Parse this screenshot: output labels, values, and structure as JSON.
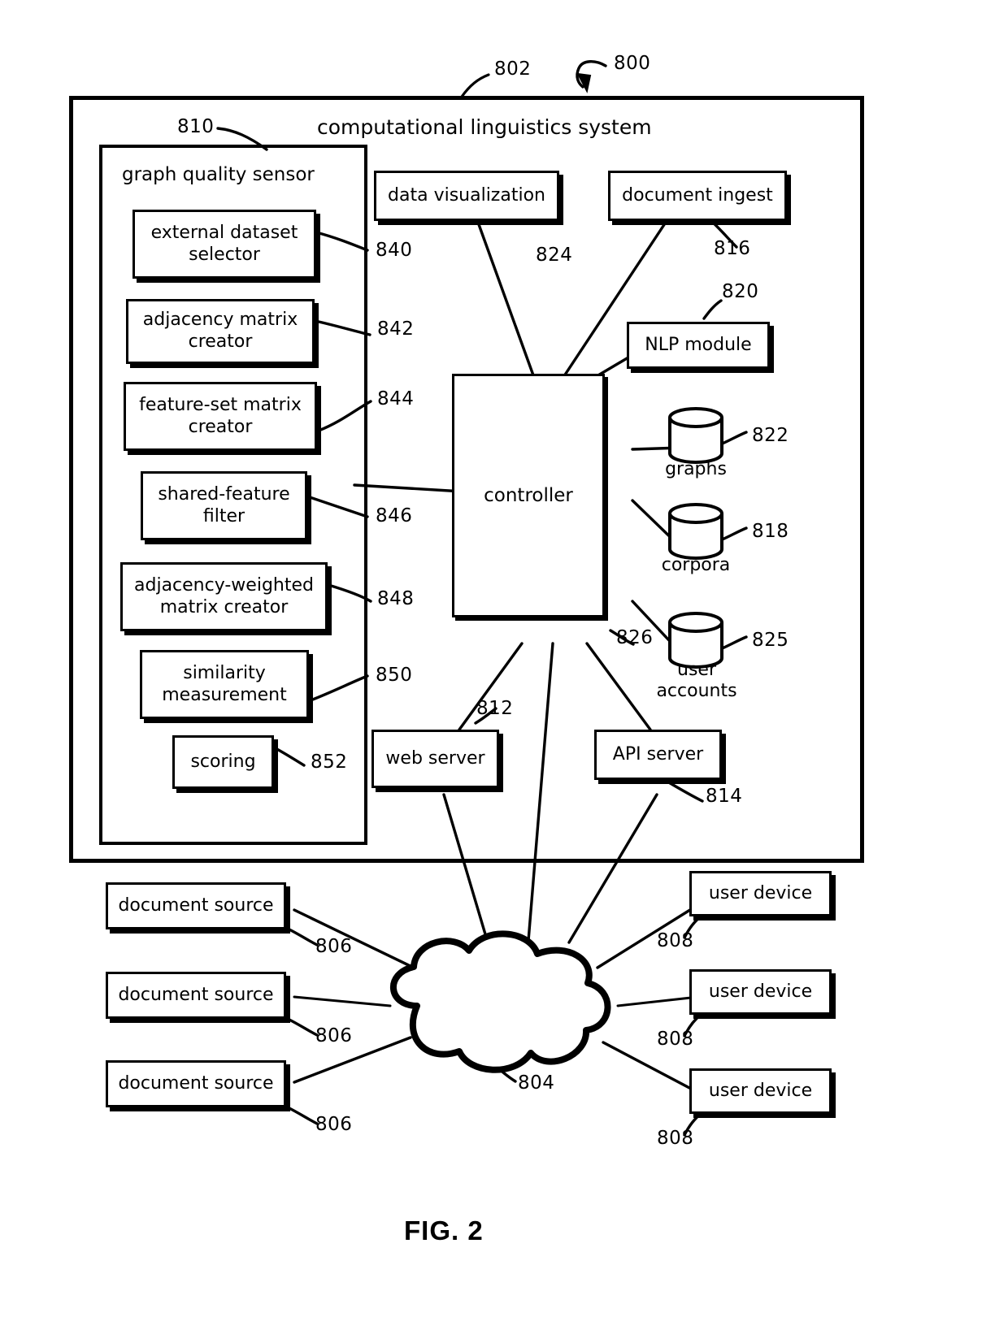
{
  "figure": {
    "caption": "FIG. 2",
    "overall_ref": "800"
  },
  "system": {
    "title": "computational linguistics system",
    "ref": "802"
  },
  "graph_quality_sensor": {
    "title": "graph quality sensor",
    "ref": "810",
    "modules": [
      {
        "label": "external dataset selector",
        "ref": "840"
      },
      {
        "label": "adjacency matrix creator",
        "ref": "842"
      },
      {
        "label": "feature-set matrix creator",
        "ref": "844"
      },
      {
        "label": "shared-feature filter",
        "ref": "846"
      },
      {
        "label": "adjacency-weighted matrix creator",
        "ref": "848"
      },
      {
        "label": "similarity measurement",
        "ref": "850"
      },
      {
        "label": "scoring",
        "ref": "852"
      }
    ]
  },
  "services": {
    "data_visualization": {
      "label": "data visualization",
      "ref": "824"
    },
    "document_ingest": {
      "label": "document ingest",
      "ref": "816"
    },
    "nlp_module": {
      "label": "NLP module",
      "ref": "820"
    },
    "controller": {
      "label": "controller",
      "ref": "826"
    },
    "web_server": {
      "label": "web server",
      "ref": "812"
    },
    "api_server": {
      "label": "API server",
      "ref": "814"
    }
  },
  "datastores": [
    {
      "label": "graphs",
      "ref": "822"
    },
    {
      "label": "corpora",
      "ref": "818"
    },
    {
      "label": "user\naccounts",
      "ref": "825"
    }
  ],
  "network": {
    "label": "",
    "ref": "804"
  },
  "document_sources": [
    {
      "label": "document source",
      "ref": "806"
    },
    {
      "label": "document source",
      "ref": "806"
    },
    {
      "label": "document source",
      "ref": "806"
    }
  ],
  "user_devices": [
    {
      "label": "user device",
      "ref": "808"
    },
    {
      "label": "user device",
      "ref": "808"
    },
    {
      "label": "user device",
      "ref": "808"
    }
  ]
}
